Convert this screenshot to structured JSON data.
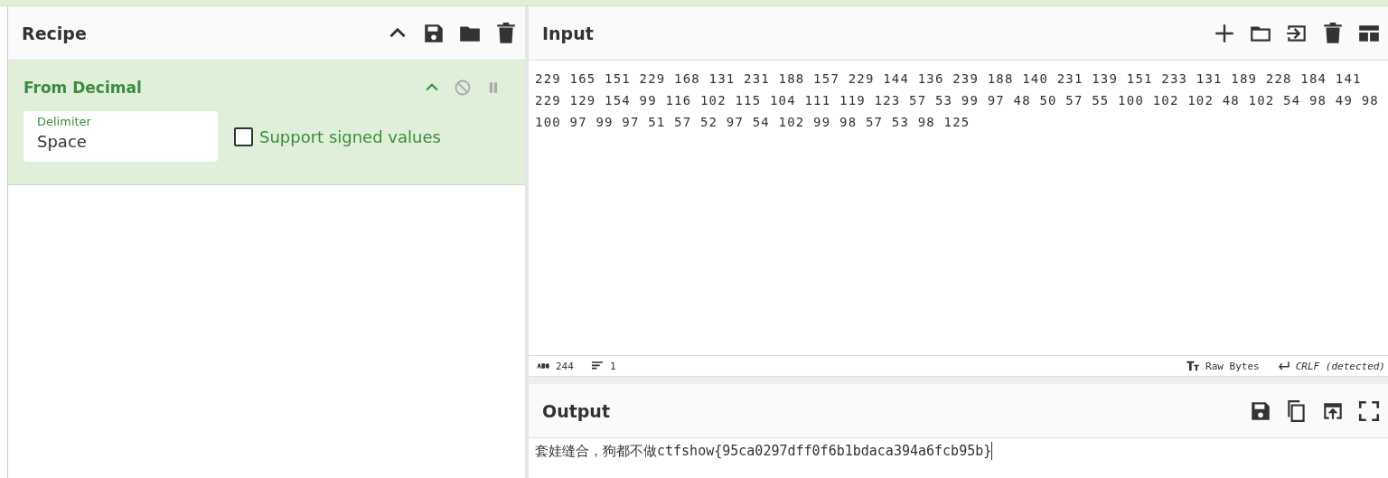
{
  "recipe": {
    "title": "Recipe",
    "operations": [
      {
        "name": "From Decimal",
        "disabled": false,
        "paused": false,
        "fields": [
          {
            "kind": "text",
            "label": "Delimiter",
            "value": "Space"
          },
          {
            "kind": "checkbox",
            "label": "Support signed values",
            "checked": false
          }
        ]
      }
    ]
  },
  "input": {
    "title": "Input",
    "text": "229 165 151 229 168 131 231 188 157 229 144 136 239 188 140 231 139 151 233 131 189 228 184 141 229 129 154 99 116 102 115 104 111 119 123 57 53 99 97 48 50 57 55 100 102 102 48 102 54 98 49 98 100 97 99 97 51 57 52 97 54 102 99 98 57 53 98 125",
    "status": {
      "length": "244",
      "lines": "1",
      "encoding": "Raw Bytes",
      "eol": "CRLF (detected)"
    }
  },
  "output": {
    "title": "Output",
    "text": "套娃缝合，狗都不做ctfshow{95ca0297dff0f6b1bdaca394a6fcb95b}"
  }
}
